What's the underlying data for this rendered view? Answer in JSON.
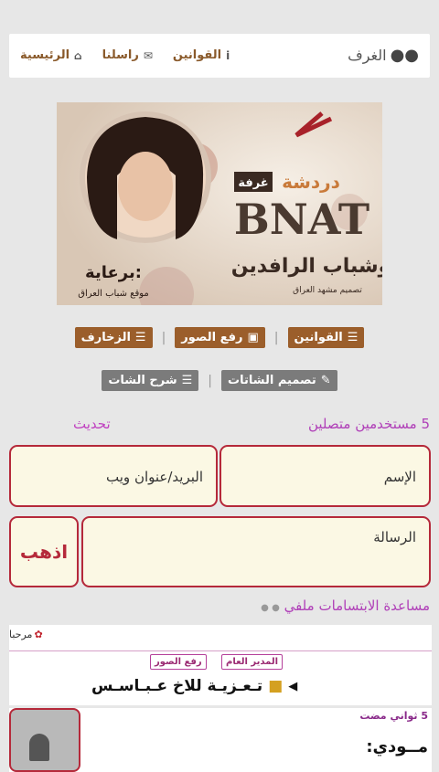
{
  "topnav": {
    "brand": "الغرف",
    "links": [
      "الرئيسية",
      "راسلنا",
      "القوانين"
    ]
  },
  "banner": {
    "text_lines": [
      "غرفة دردشة",
      "BNAT",
      "وشباب الرافدين",
      "برعاية",
      "موقع شباب العراق",
      "تصميم مشهد العراق"
    ]
  },
  "buttons_row1": [
    "القوانين",
    "رفع الصور",
    "الزخارف"
  ],
  "buttons_row2": [
    "تصميم الشاتات",
    "شرح الشات"
  ],
  "status": {
    "online": "5 مستخدمين متصلين",
    "refresh": "تحديث"
  },
  "form": {
    "name_placeholder": "الإسم",
    "email_placeholder": "البريد/عنوان ويب",
    "message_placeholder": "الرسالة",
    "go_label": "اذهب"
  },
  "smileys_label": "مساعدة الابتسامات ملفي",
  "chat": {
    "welcome": "مرحبا",
    "badges": [
      "المدير العام",
      "رفع الصور"
    ],
    "announcement": "تـعـزيـة للاخ عـبـاسـس"
  },
  "latest": {
    "time": "5 ثواني مضت",
    "user": "مــودي:"
  },
  "colors": {
    "accent_brown": "#9b5e2b",
    "field_border": "#b5293a",
    "status_purple": "#b040b8",
    "refresh_color": "#c040c0"
  }
}
